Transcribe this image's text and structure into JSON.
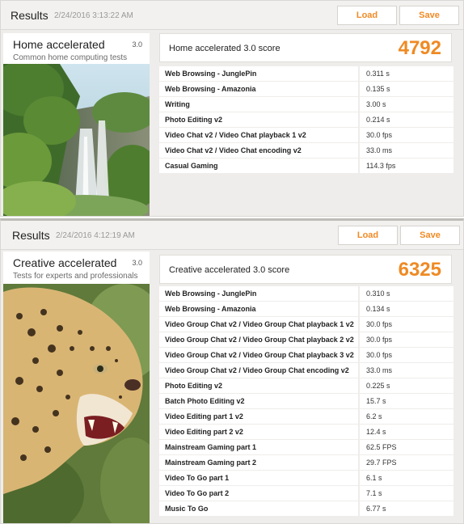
{
  "results": [
    {
      "header_title": "Results",
      "timestamp": "2/24/2016 3:13:22 AM",
      "load_label": "Load",
      "save_label": "Save",
      "test_name": "Home accelerated",
      "version": "3.0",
      "subtitle": "Common home computing tests",
      "score_label": "Home accelerated 3.0 score",
      "score": "4792",
      "rows": [
        {
          "name": "Web Browsing - JunglePin",
          "value": "0.311 s"
        },
        {
          "name": "Web Browsing - Amazonia",
          "value": "0.135 s"
        },
        {
          "name": "Writing",
          "value": "3.00 s"
        },
        {
          "name": "Photo Editing v2",
          "value": "0.214 s"
        },
        {
          "name": "Video Chat v2 / Video Chat playback 1 v2",
          "value": "30.0 fps"
        },
        {
          "name": "Video Chat v2 / Video Chat encoding v2",
          "value": "33.0 ms"
        },
        {
          "name": "Casual Gaming",
          "value": "114.3 fps"
        }
      ]
    },
    {
      "header_title": "Results",
      "timestamp": "2/24/2016 4:12:19 AM",
      "load_label": "Load",
      "save_label": "Save",
      "test_name": "Creative accelerated",
      "version": "3.0",
      "subtitle": "Tests for experts and professionals",
      "score_label": "Creative accelerated 3.0 score",
      "score": "6325",
      "rows": [
        {
          "name": "Web Browsing - JunglePin",
          "value": "0.310 s"
        },
        {
          "name": "Web Browsing - Amazonia",
          "value": "0.134 s"
        },
        {
          "name": "Video Group Chat v2 / Video Group Chat playback 1 v2",
          "value": "30.0 fps"
        },
        {
          "name": "Video Group Chat v2 / Video Group Chat playback 2 v2",
          "value": "30.0 fps"
        },
        {
          "name": "Video Group Chat v2 / Video Group Chat playback 3 v2",
          "value": "30.0 fps"
        },
        {
          "name": "Video Group Chat v2 / Video Group Chat encoding v2",
          "value": "33.0 ms"
        },
        {
          "name": "Photo Editing v2",
          "value": "0.225 s"
        },
        {
          "name": "Batch Photo Editing v2",
          "value": "15.7 s"
        },
        {
          "name": "Video Editing part 1 v2",
          "value": "6.2 s"
        },
        {
          "name": "Video Editing part 2 v2",
          "value": "12.4 s"
        },
        {
          "name": "Mainstream Gaming part 1",
          "value": "62.5 FPS"
        },
        {
          "name": "Mainstream Gaming part 2",
          "value": "29.7 FPS"
        },
        {
          "name": "Video To Go part 1",
          "value": "6.1 s"
        },
        {
          "name": "Video To Go part 2",
          "value": "7.1 s"
        },
        {
          "name": "Music To Go",
          "value": "6.77 s"
        }
      ]
    }
  ],
  "colors": {
    "accent": "#ef8a24",
    "panel_bg": "#eeedeb",
    "card_bg": "#ffffff"
  },
  "images": [
    "waterfall-photo",
    "leopard-photo"
  ]
}
